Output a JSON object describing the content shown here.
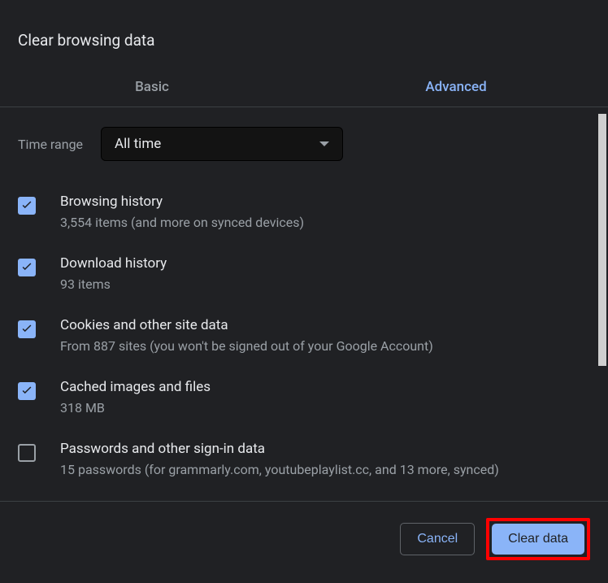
{
  "dialog": {
    "title": "Clear browsing data"
  },
  "tabs": {
    "basic": "Basic",
    "advanced": "Advanced"
  },
  "timeRange": {
    "label": "Time range",
    "value": "All time"
  },
  "options": [
    {
      "checked": true,
      "title": "Browsing history",
      "sub": "3,554 items (and more on synced devices)"
    },
    {
      "checked": true,
      "title": "Download history",
      "sub": "93 items"
    },
    {
      "checked": true,
      "title": "Cookies and other site data",
      "sub": "From 887 sites (you won't be signed out of your Google Account)"
    },
    {
      "checked": true,
      "title": "Cached images and files",
      "sub": "318 MB"
    },
    {
      "checked": false,
      "title": "Passwords and other sign-in data",
      "sub": "15 passwords (for grammarly.com, youtubeplaylist.cc, and 13 more, synced)"
    }
  ],
  "buttons": {
    "cancel": "Cancel",
    "clear": "Clear data"
  }
}
